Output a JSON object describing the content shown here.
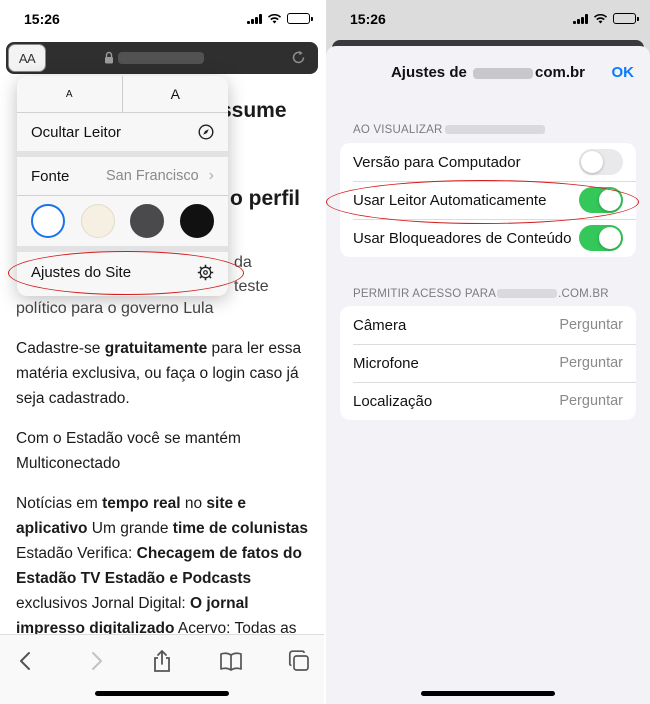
{
  "left": {
    "status": {
      "time": "15:26"
    },
    "urlbar": {
      "aa_label": "AA"
    },
    "article": {
      "headline1": "ssume",
      "headline2": "o perfil",
      "sub1": "da",
      "sub2": "teste",
      "sub3": "político para o governo Lula",
      "paragraphs": [
        [
          {
            "t": "Cadastre-se "
          },
          {
            "b": "gratuitamente"
          },
          {
            "t": " para ler essa matéria exclusiva, ou faça o login caso já seja cadastrado."
          }
        ],
        [
          {
            "t": "Com o Estadão você se mantém Multiconectado"
          }
        ],
        [
          {
            "t": "Notícias em "
          },
          {
            "b": "tempo real"
          },
          {
            "t": " no "
          },
          {
            "b": "site e aplicativo"
          },
          {
            "t": " Um grande "
          },
          {
            "b": "time de colunistas"
          },
          {
            "t": " Estadão Verifica: "
          },
          {
            "b": "Checagem de fatos do Estadão TV Estadão e Podcasts"
          },
          {
            "t": " exclusivos Jornal Digital: "
          },
          {
            "b": "O jornal impresso digitalizado"
          },
          {
            "t": " Acervo: Todas as"
          }
        ]
      ]
    },
    "reader_menu": {
      "size_small": "A",
      "size_large": "A",
      "hide_reader": "Ocultar Leitor",
      "font_label": "Fonte",
      "font_value": "San Francisco",
      "themes": [
        {
          "name": "white",
          "color": "#ffffff",
          "border": "#1a73e8"
        },
        {
          "name": "sepia",
          "color": "#f5f0e1",
          "border": "#e0dccc"
        },
        {
          "name": "gray",
          "color": "#4a4a4c",
          "border": "#4a4a4c"
        },
        {
          "name": "black",
          "color": "#111111",
          "border": "#111111"
        }
      ],
      "site_settings": "Ajustes do Site"
    }
  },
  "right": {
    "status": {
      "time": "15:26"
    },
    "sheet": {
      "title_prefix": "Ajustes de",
      "title_suffix": "com.br",
      "ok": "OK",
      "section1_header": "AO VISUALIZAR",
      "section1_items": [
        {
          "label": "Versão para Computador",
          "on": false
        },
        {
          "label": "Usar Leitor Automaticamente",
          "on": true
        },
        {
          "label": "Usar Bloqueadores de Conteúdo",
          "on": true
        }
      ],
      "section2_header_prefix": "PERMITIR ACESSO PARA",
      "section2_header_suffix": ".COM.BR",
      "section2_items": [
        {
          "label": "Câmera",
          "value": "Perguntar"
        },
        {
          "label": "Microfone",
          "value": "Perguntar"
        },
        {
          "label": "Localização",
          "value": "Perguntar"
        }
      ]
    }
  },
  "colors": {
    "accent": "#0a7aff",
    "toggle_on": "#34c759",
    "highlight": "#d41c1c"
  }
}
